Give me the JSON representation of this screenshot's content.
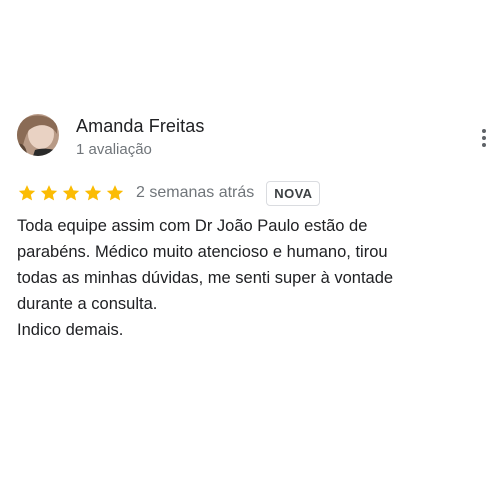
{
  "reviewer": {
    "name": "Amanda Freitas",
    "review_count": "1 avaliação"
  },
  "review": {
    "rating": 5,
    "max_rating": 5,
    "date": "2 semanas atrás",
    "badge": "NOVA",
    "text_lines": [
      "Toda equipe assim com Dr João Paulo estão de",
      "parabéns. Médico muito atencioso e humano, tirou",
      "todas as minhas dúvidas, me senti super à vontade",
      "durante a consulta.",
      "Indico demais."
    ]
  },
  "icons": {
    "star": "star-icon",
    "more": "more-vert-icon"
  },
  "colors": {
    "star": "#fbbc04",
    "primary_text": "#202124",
    "secondary_text": "#70757a",
    "badge_border": "#dadce0"
  }
}
